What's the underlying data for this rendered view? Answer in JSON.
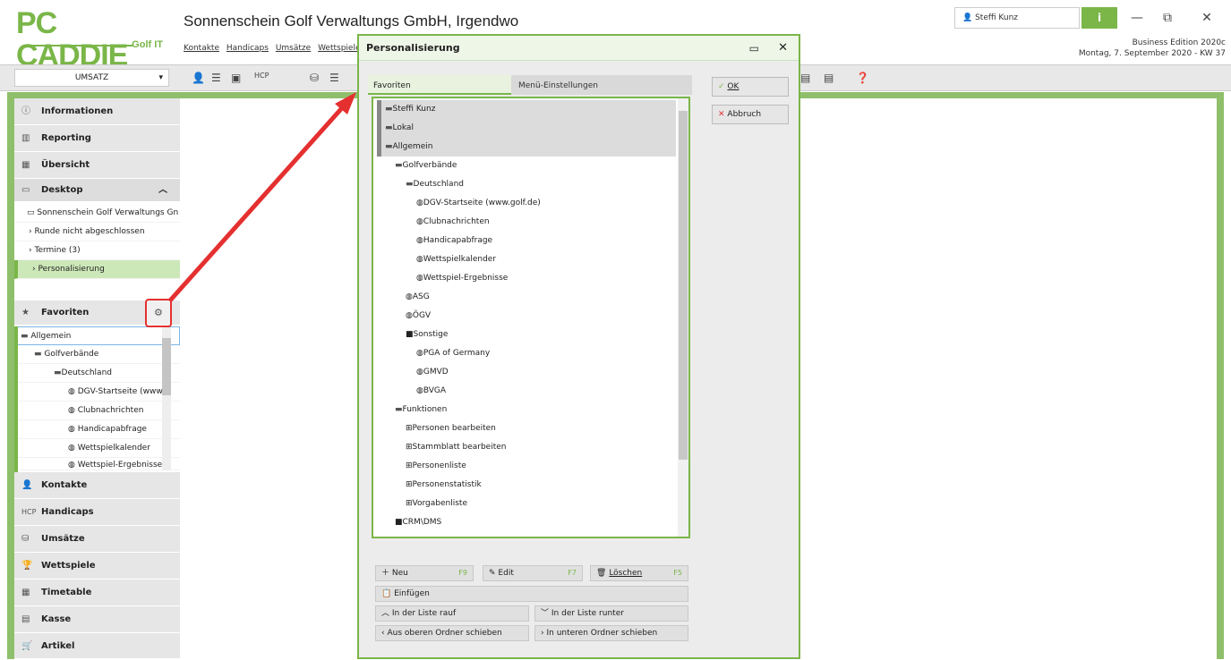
{
  "logo": {
    "main": "PC CADDIE",
    "sub": "Golf IT"
  },
  "app_title": "Sonnenschein Golf Verwaltungs GmbH, Irgendwo",
  "menu": [
    "Kontakte",
    "Handicaps",
    "Umsätze",
    "Wettspiele"
  ],
  "user": "Steffi Kunz",
  "info_label": "i",
  "window_buttons": {
    "minimize": "—",
    "restore": "⧉",
    "close": "✕"
  },
  "edition": {
    "line1": "Business Edition 2020c",
    "line2": "Montag, 7. September 2020 - KW 37"
  },
  "toolbar": {
    "umsatz": "UMSATZ"
  },
  "sidebar": {
    "sections": [
      {
        "label": "Informationen",
        "icon": "ⓘ"
      },
      {
        "label": "Reporting",
        "icon": "📊"
      },
      {
        "label": "Übersicht",
        "icon": "▦"
      },
      {
        "label": "Desktop",
        "icon": "▭"
      }
    ],
    "desktop_items": [
      "Sonnenschein Golf Verwaltungs Gn",
      "Runde nicht abgeschlossen",
      "Termine (3)",
      "Personalisierung"
    ],
    "favoriten": "Favoriten",
    "fav_tree": [
      "Allgemein",
      "Golfverbände",
      "Deutschland",
      "DGV-Startseite (www",
      "Clubnachrichten",
      "Handicapabfrage",
      "Wettspielkalender",
      "Wettspiel-Ergebnisse"
    ],
    "bottom": [
      "Kontakte",
      "Handicaps",
      "Umsätze",
      "Wettspiele",
      "Timetable",
      "Kasse",
      "Artikel"
    ]
  },
  "dialog": {
    "title": "Personalisierung",
    "tabs": {
      "fav": "Favoriten",
      "menu": "Menü-Einstellungen"
    },
    "ok": "OK",
    "cancel": "Abbruch",
    "tree": [
      "Steffi Kunz",
      "Lokal",
      "Allgemein",
      "Golfverbände",
      "Deutschland",
      "DGV-Startseite (www.golf.de)",
      "Clubnachrichten",
      "Handicapabfrage",
      "Wettspielkalender",
      "Wettspiel-Ergebnisse",
      "ASG",
      "ÖGV",
      "Sonstige",
      "PGA of Germany",
      "GMVD",
      "BVGA",
      "Funktionen",
      "Personen bearbeiten",
      "Stammblatt bearbeiten",
      "Personenliste",
      "Personenstatistik",
      "Vorgabenliste",
      "CRM\\DMS"
    ],
    "buttons": {
      "neu": "Neu",
      "neu_key": "F9",
      "edit": "Edit",
      "edit_key": "F7",
      "loeschen": "Löschen",
      "loeschen_key": "F5",
      "einfuegen": "Einfügen",
      "rauf": "In der Liste rauf",
      "runter": "In der Liste runter",
      "oben": "Aus oberen Ordner schieben",
      "unten": "In unteren Ordner schieben"
    }
  },
  "colors": {
    "accent": "#7ab648",
    "arrow": "#e53030"
  }
}
